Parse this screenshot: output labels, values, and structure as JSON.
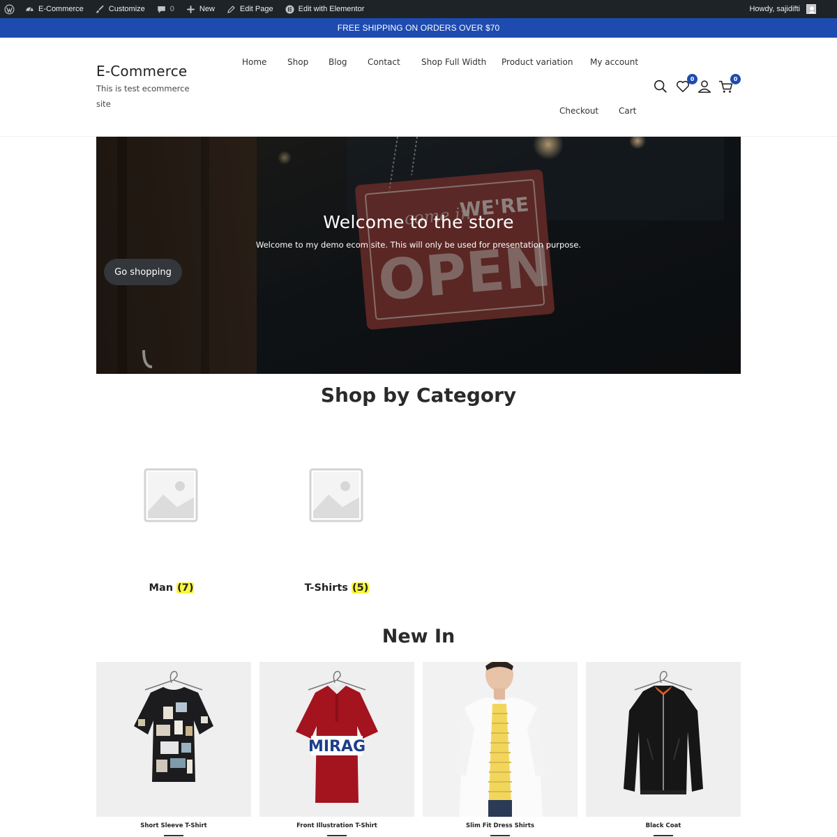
{
  "admin_bar": {
    "site_name": "E-Commerce",
    "customize": "Customize",
    "comments_count": "0",
    "new": "New",
    "edit_page": "Edit Page",
    "edit_elementor": "Edit with Elementor",
    "howdy": "Howdy, sajidifti"
  },
  "promo": {
    "text": "FREE SHIPPING ON ORDERS OVER $70"
  },
  "header": {
    "site_title": "E-Commerce",
    "site_description": "This is test ecommerce site",
    "nav": {
      "home": "Home",
      "shop": "Shop",
      "blog": "Blog",
      "contact": "Contact",
      "shop_full_width": "Shop Full Width",
      "product_variation": "Product variation",
      "my_account": "My account",
      "checkout": "Checkout",
      "cart": "Cart"
    },
    "wishlist_count": "0",
    "cart_count": "0",
    "icons": [
      "search-icon",
      "heart-icon",
      "user-icon",
      "cart-icon"
    ]
  },
  "hero": {
    "title": "Welcome to the store",
    "subtitle": "Welcome to my demo ecom site. This will only be used for presentation purpose.",
    "button": "Go shopping",
    "sign_script": "come in",
    "sign_top": "WE'RE",
    "sign_main": "OPEN"
  },
  "categories": {
    "title": "Shop by Category",
    "items": [
      {
        "name": "Man",
        "count": "(7)"
      },
      {
        "name": "T-Shirts",
        "count": "(5)"
      }
    ]
  },
  "new_in": {
    "title": "New In",
    "products": [
      {
        "name": "Short Sleeve T-Shirt"
      },
      {
        "name": "Front Illustration T-Shirt",
        "print": "MIRAG"
      },
      {
        "name": "Slim Fit Dress Shirts"
      },
      {
        "name": "Black Coat"
      }
    ]
  },
  "colors": {
    "admin_bar": "#1d2327",
    "accent_blue": "#1e4bb0",
    "count_highlight": "#fbf73a",
    "product_bg": "#efefef"
  }
}
